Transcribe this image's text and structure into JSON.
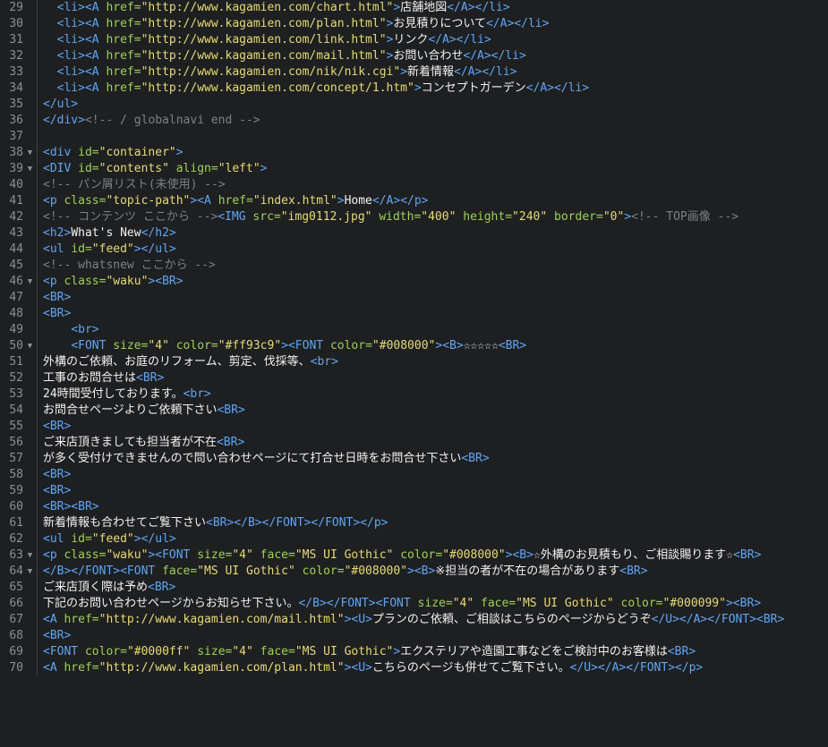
{
  "editor": {
    "background": "#1e1f21",
    "colors": {
      "tag": "#5fa6f5",
      "attr": "#9fd254",
      "string": "#e6db74",
      "comment": "#7c8088",
      "text": "#f2f2f2",
      "line_number": "#8a8f96"
    },
    "lines": [
      {
        "n": "29",
        "indent": "  ",
        "tokens": [
          [
            "tag",
            "<li><A "
          ],
          [
            "attr",
            "href="
          ],
          [
            "str",
            "\"http://www.kagamien.com/chart.html\""
          ],
          [
            "tag",
            ">"
          ],
          [
            "txt",
            "店舗地図"
          ],
          [
            "tag",
            "</A></li>"
          ]
        ]
      },
      {
        "n": "30",
        "indent": "  ",
        "tokens": [
          [
            "tag",
            "<li><A "
          ],
          [
            "attr",
            "href="
          ],
          [
            "str",
            "\"http://www.kagamien.com/plan.html\""
          ],
          [
            "tag",
            ">"
          ],
          [
            "txt",
            "お見積りについて"
          ],
          [
            "tag",
            "</A></li>"
          ]
        ]
      },
      {
        "n": "31",
        "indent": "  ",
        "tokens": [
          [
            "tag",
            "<li><A "
          ],
          [
            "attr",
            "href="
          ],
          [
            "str",
            "\"http://www.kagamien.com/link.html\""
          ],
          [
            "tag",
            ">"
          ],
          [
            "txt",
            "リンク"
          ],
          [
            "tag",
            "</A></li>"
          ]
        ]
      },
      {
        "n": "32",
        "indent": "  ",
        "tokens": [
          [
            "tag",
            "<li><A "
          ],
          [
            "attr",
            "href="
          ],
          [
            "str",
            "\"http://www.kagamien.com/mail.html\""
          ],
          [
            "tag",
            ">"
          ],
          [
            "txt",
            "お問い合わせ"
          ],
          [
            "tag",
            "</A></li>"
          ]
        ]
      },
      {
        "n": "33",
        "indent": "  ",
        "tokens": [
          [
            "tag",
            "<li><A "
          ],
          [
            "attr",
            "href="
          ],
          [
            "str",
            "\"http://www.kagamien.com/nik/nik.cgi\""
          ],
          [
            "tag",
            ">"
          ],
          [
            "txt",
            "新着情報"
          ],
          [
            "tag",
            "</A></li>"
          ]
        ]
      },
      {
        "n": "34",
        "indent": "  ",
        "tokens": [
          [
            "tag",
            "<li><A "
          ],
          [
            "attr",
            "href="
          ],
          [
            "str",
            "\"http://www.kagamien.com/concept/1.htm\""
          ],
          [
            "tag",
            ">"
          ],
          [
            "txt",
            "コンセプトガーデン"
          ],
          [
            "tag",
            "</A></li>"
          ]
        ]
      },
      {
        "n": "35",
        "tokens": [
          [
            "tag",
            "</ul>"
          ]
        ]
      },
      {
        "n": "36",
        "tokens": [
          [
            "tag",
            "</div>"
          ],
          [
            "com",
            "<!-- / globalnavi end -->"
          ]
        ]
      },
      {
        "n": "37",
        "tokens": []
      },
      {
        "n": "38",
        "fold": true,
        "tokens": [
          [
            "tag",
            "<div "
          ],
          [
            "attr",
            "id="
          ],
          [
            "str",
            "\"container\""
          ],
          [
            "tag",
            ">"
          ]
        ]
      },
      {
        "n": "39",
        "fold": true,
        "tokens": [
          [
            "tag",
            "<DIV "
          ],
          [
            "attr",
            "id="
          ],
          [
            "str",
            "\"contents\" "
          ],
          [
            "attr",
            "align="
          ],
          [
            "str",
            "\"left\""
          ],
          [
            "tag",
            ">"
          ]
        ]
      },
      {
        "n": "40",
        "tokens": [
          [
            "com",
            "<!-- パン屑リスト(未使用) -->"
          ]
        ]
      },
      {
        "n": "41",
        "tokens": [
          [
            "tag",
            "<p "
          ],
          [
            "attr",
            "class="
          ],
          [
            "str",
            "\"topic-path\""
          ],
          [
            "tag",
            "><A "
          ],
          [
            "attr",
            "href="
          ],
          [
            "str",
            "\"index.html\""
          ],
          [
            "tag",
            ">"
          ],
          [
            "txt",
            "Home"
          ],
          [
            "tag",
            "</A></p>"
          ]
        ]
      },
      {
        "n": "42",
        "tokens": [
          [
            "com",
            "<!-- コンテンツ ここから -->"
          ],
          [
            "tag",
            "<IMG "
          ],
          [
            "attr",
            "src="
          ],
          [
            "str",
            "\"img0112.jpg\" "
          ],
          [
            "attr",
            "width="
          ],
          [
            "str",
            "\"400\" "
          ],
          [
            "attr",
            "height="
          ],
          [
            "str",
            "\"240\" "
          ],
          [
            "attr",
            "border="
          ],
          [
            "str",
            "\"0\""
          ],
          [
            "tag",
            ">"
          ],
          [
            "com",
            "<!-- TOP画像 -->"
          ]
        ]
      },
      {
        "n": "43",
        "tokens": [
          [
            "tag",
            "<h2>"
          ],
          [
            "txt",
            "What's New"
          ],
          [
            "tag",
            "</h2>"
          ]
        ]
      },
      {
        "n": "44",
        "tokens": [
          [
            "tag",
            "<ul "
          ],
          [
            "attr",
            "id="
          ],
          [
            "str",
            "\"feed\""
          ],
          [
            "tag",
            "></ul>"
          ]
        ]
      },
      {
        "n": "45",
        "tokens": [
          [
            "com",
            "<!-- whatsnew ここから -->"
          ]
        ]
      },
      {
        "n": "46",
        "fold": true,
        "tokens": [
          [
            "tag",
            "<p "
          ],
          [
            "attr",
            "class="
          ],
          [
            "str",
            "\"waku\""
          ],
          [
            "tag",
            "><BR>"
          ]
        ]
      },
      {
        "n": "47",
        "tokens": [
          [
            "tag",
            "<BR>"
          ]
        ]
      },
      {
        "n": "48",
        "tokens": [
          [
            "tag",
            "<BR>"
          ]
        ]
      },
      {
        "n": "49",
        "indent": "    ",
        "tokens": [
          [
            "tag",
            "<br>"
          ]
        ]
      },
      {
        "n": "50",
        "fold": true,
        "indent": "    ",
        "tokens": [
          [
            "tag",
            "<FONT "
          ],
          [
            "attr",
            "size="
          ],
          [
            "str",
            "\"4\" "
          ],
          [
            "attr",
            "color="
          ],
          [
            "str",
            "\"#ff93c9\""
          ],
          [
            "tag",
            "><FONT "
          ],
          [
            "attr",
            "color="
          ],
          [
            "str",
            "\"#008000\""
          ],
          [
            "tag",
            "><B>"
          ],
          [
            "txt",
            "☆☆☆☆☆"
          ],
          [
            "tag",
            "<BR>"
          ]
        ]
      },
      {
        "n": "51",
        "tokens": [
          [
            "txt",
            "外構のご依頼、お庭のリフォーム、剪定、伐採等、"
          ],
          [
            "tag",
            "<br>"
          ]
        ]
      },
      {
        "n": "52",
        "tokens": [
          [
            "txt",
            "工事のお問合せは"
          ],
          [
            "tag",
            "<BR>"
          ]
        ]
      },
      {
        "n": "53",
        "tokens": [
          [
            "txt",
            "24時間受付しております。"
          ],
          [
            "tag",
            "<br>"
          ]
        ]
      },
      {
        "n": "54",
        "tokens": [
          [
            "txt",
            "お問合せページよりご依頼下さい"
          ],
          [
            "tag",
            "<BR>"
          ]
        ]
      },
      {
        "n": "55",
        "tokens": [
          [
            "tag",
            "<BR>"
          ]
        ]
      },
      {
        "n": "56",
        "tokens": [
          [
            "txt",
            "ご来店頂きましても担当者が不在"
          ],
          [
            "tag",
            "<BR>"
          ]
        ]
      },
      {
        "n": "57",
        "tokens": [
          [
            "txt",
            "が多く受付けできませんので問い合わせページにて打合せ日時をお問合せ下さい"
          ],
          [
            "tag",
            "<BR>"
          ]
        ]
      },
      {
        "n": "58",
        "tokens": [
          [
            "tag",
            "<BR>"
          ]
        ]
      },
      {
        "n": "59",
        "tokens": [
          [
            "tag",
            "<BR>"
          ]
        ]
      },
      {
        "n": "60",
        "tokens": [
          [
            "tag",
            "<BR><BR>"
          ]
        ]
      },
      {
        "n": "61",
        "tokens": [
          [
            "txt",
            "新着情報も合わせてご覧下さい"
          ],
          [
            "tag",
            "<BR></B></FONT></FONT></p>"
          ]
        ]
      },
      {
        "n": "62",
        "tokens": [
          [
            "tag",
            "<ul "
          ],
          [
            "attr",
            "id="
          ],
          [
            "str",
            "\"feed\""
          ],
          [
            "tag",
            "></ul>"
          ]
        ]
      },
      {
        "n": "63",
        "fold": true,
        "tokens": [
          [
            "tag",
            "<p "
          ],
          [
            "attr",
            "class="
          ],
          [
            "str",
            "\"waku\""
          ],
          [
            "tag",
            "><FONT "
          ],
          [
            "attr",
            "size="
          ],
          [
            "str",
            "\"4\" "
          ],
          [
            "attr",
            "face="
          ],
          [
            "str",
            "\"MS UI Gothic\" "
          ],
          [
            "attr",
            "color="
          ],
          [
            "str",
            "\"#008000\""
          ],
          [
            "tag",
            "><B>"
          ],
          [
            "txt",
            "☆外構のお見積もり、ご相談賜ります☆"
          ],
          [
            "tag",
            "<BR>"
          ]
        ]
      },
      {
        "n": "64",
        "fold": true,
        "tokens": [
          [
            "tag",
            "</B></FONT><FONT "
          ],
          [
            "attr",
            "face="
          ],
          [
            "str",
            "\"MS UI Gothic\" "
          ],
          [
            "attr",
            "color="
          ],
          [
            "str",
            "\"#008000\""
          ],
          [
            "tag",
            "><B>"
          ],
          [
            "txt",
            "※担当の者が不在の場合があります"
          ],
          [
            "tag",
            "<BR>"
          ]
        ]
      },
      {
        "n": "65",
        "tokens": [
          [
            "txt",
            "ご来店頂く際は予め"
          ],
          [
            "tag",
            "<BR>"
          ]
        ]
      },
      {
        "n": "66",
        "tokens": [
          [
            "txt",
            "下記のお問い合わせページからお知らせ下さい。"
          ],
          [
            "tag",
            "</B></FONT><FONT "
          ],
          [
            "attr",
            "size="
          ],
          [
            "str",
            "\"4\" "
          ],
          [
            "attr",
            "face="
          ],
          [
            "str",
            "\"MS UI Gothic\" "
          ],
          [
            "attr",
            "color="
          ],
          [
            "str",
            "\"#000099\""
          ],
          [
            "tag",
            "><BR>"
          ]
        ]
      },
      {
        "n": "67",
        "tokens": [
          [
            "tag",
            "<A "
          ],
          [
            "attr",
            "href="
          ],
          [
            "str",
            "\"http://www.kagamien.com/mail.html\""
          ],
          [
            "tag",
            "><U>"
          ],
          [
            "txt",
            "プランのご依頼、ご相談はこちらのページからどうぞ"
          ],
          [
            "tag",
            "</U></A></FONT><BR>"
          ]
        ]
      },
      {
        "n": "68",
        "tokens": [
          [
            "tag",
            "<BR>"
          ]
        ]
      },
      {
        "n": "69",
        "tokens": [
          [
            "tag",
            "<FONT "
          ],
          [
            "attr",
            "color="
          ],
          [
            "str",
            "\"#0000ff\" "
          ],
          [
            "attr",
            "size="
          ],
          [
            "str",
            "\"4\" "
          ],
          [
            "attr",
            "face="
          ],
          [
            "str",
            "\"MS UI Gothic\""
          ],
          [
            "tag",
            ">"
          ],
          [
            "txt",
            "エクステリアや造園工事などをご検討中のお客様は"
          ],
          [
            "tag",
            "<BR>"
          ]
        ]
      },
      {
        "n": "70",
        "tokens": [
          [
            "tag",
            "<A "
          ],
          [
            "attr",
            "href="
          ],
          [
            "str",
            "\"http://www.kagamien.com/plan.html\""
          ],
          [
            "tag",
            "><U>"
          ],
          [
            "txt",
            "こちらのページも併せてご覧下さい。"
          ],
          [
            "tag",
            "</U></A></FONT></p>"
          ]
        ]
      }
    ]
  }
}
